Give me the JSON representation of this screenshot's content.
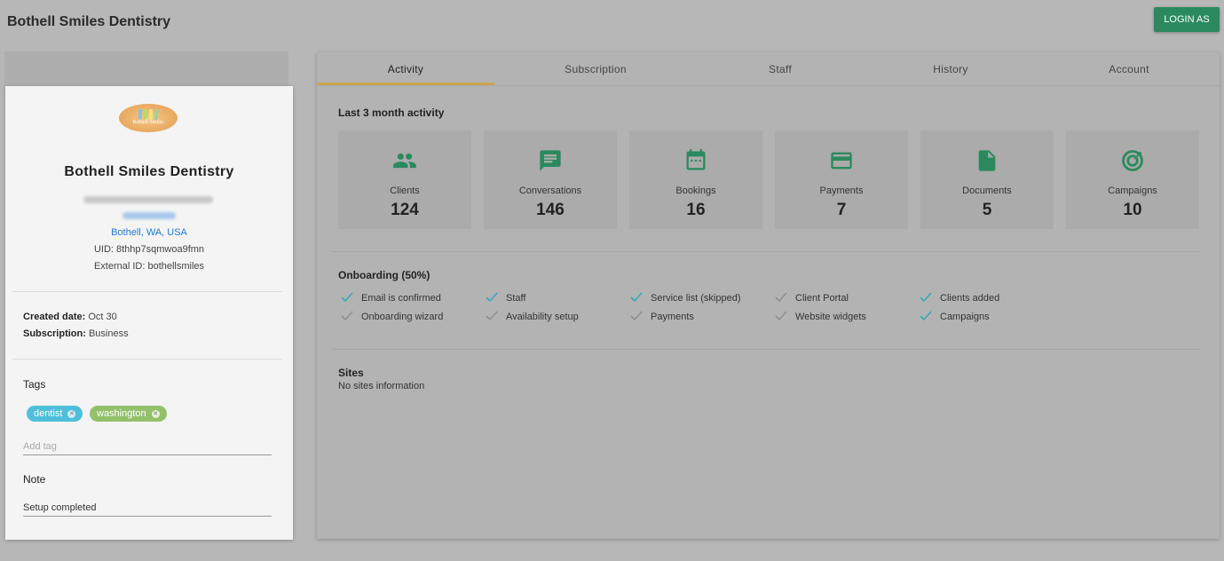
{
  "header": {
    "title": "Bothell Smiles Dentistry",
    "login_label": "LOGIN AS"
  },
  "profile": {
    "logo_text": "Bothell Smiles",
    "name": "Bothell Smiles Dentistry",
    "location": "Bothell, WA, USA",
    "uid": "UID: 8thhp7sqmwoa9fmn",
    "external_id": "External ID: bothellsmiles",
    "created_label": "Created date:",
    "created_value": "Oct 30",
    "subscription_label": "Subscription:",
    "subscription_value": "Business",
    "tags_title": "Tags",
    "tags": [
      {
        "label": "dentist",
        "color": "#4fbfd9"
      },
      {
        "label": "washington",
        "color": "#93c16a"
      }
    ],
    "add_tag_placeholder": "Add tag",
    "note_title": "Note",
    "note_value": "Setup completed"
  },
  "tabs": [
    {
      "label": "Activity",
      "active": true
    },
    {
      "label": "Subscription",
      "active": false
    },
    {
      "label": "Staff",
      "active": false
    },
    {
      "label": "History",
      "active": false
    },
    {
      "label": "Account",
      "active": false
    }
  ],
  "activity": {
    "title": "Last 3 month activity",
    "stats": [
      {
        "label": "Clients",
        "value": "124",
        "icon": "people-icon"
      },
      {
        "label": "Conversations",
        "value": "146",
        "icon": "chat-icon"
      },
      {
        "label": "Bookings",
        "value": "16",
        "icon": "calendar-icon"
      },
      {
        "label": "Payments",
        "value": "7",
        "icon": "credit-card-icon"
      },
      {
        "label": "Documents",
        "value": "5",
        "icon": "document-icon"
      },
      {
        "label": "Campaigns",
        "value": "10",
        "icon": "target-icon"
      }
    ],
    "icon_color": "#2a8a5e"
  },
  "onboarding": {
    "title": "Onboarding (50%)",
    "items": [
      {
        "label": "Email is confirmed",
        "done": true
      },
      {
        "label": "Staff",
        "done": true
      },
      {
        "label": "Service list (skipped)",
        "done": true
      },
      {
        "label": "Client Portal",
        "done": false
      },
      {
        "label": "Clients added",
        "done": true
      },
      {
        "label": "Onboarding wizard",
        "done": false
      },
      {
        "label": "Availability setup",
        "done": false
      },
      {
        "label": "Payments",
        "done": false
      },
      {
        "label": "Website widgets",
        "done": false
      },
      {
        "label": "Campaigns",
        "done": true
      }
    ],
    "done_color": "#3aa7b8",
    "pending_color": "#8e8e8e"
  },
  "sites": {
    "title": "Sites",
    "empty_text": "No sites information"
  }
}
